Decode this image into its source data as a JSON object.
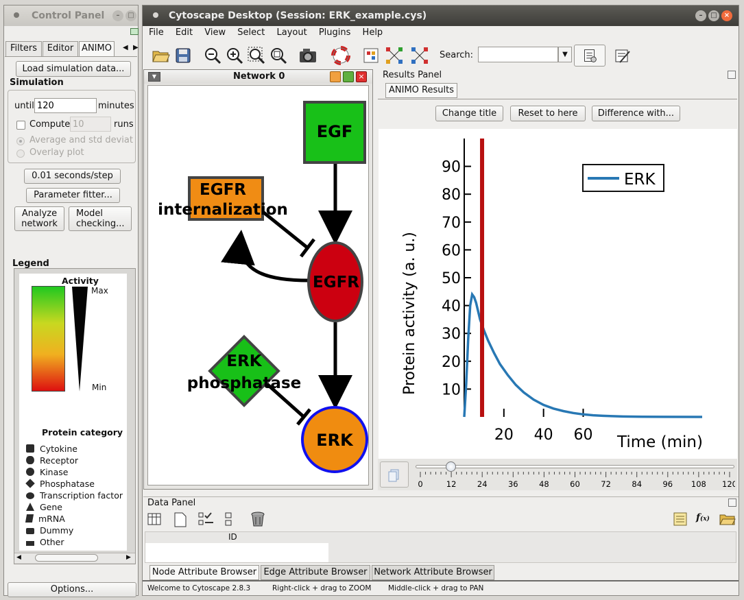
{
  "control_panel": {
    "title": "Control Panel",
    "tabs": [
      "Filters",
      "Editor",
      "ANIMO"
    ],
    "load_button": "Load simulation data...",
    "simulation_heading": "Simulation",
    "until_label": "until",
    "until_value": "120",
    "minutes_label": "minutes",
    "compute_label": "Compute",
    "compute_value": "10",
    "runs_label": "runs",
    "average_label": "Average and std deviati",
    "overlay_label": "Overlay plot",
    "seconds_button": "0.01 seconds/step",
    "parameter_button": "Parameter fitter...",
    "analyze_button_1": "Analyze",
    "analyze_button_2": "network",
    "model_button_1": "Model",
    "model_button_2": "checking...",
    "legend_heading": "Legend",
    "activity_label": "Activity",
    "max_label": "Max",
    "min_label": "Min",
    "protein_category_label": "Protein category",
    "categories": [
      "Cytokine",
      "Receptor",
      "Kinase",
      "Phosphatase",
      "Transcription factor",
      "Gene",
      "mRNA",
      "Dummy",
      "Other"
    ],
    "options_button": "Options..."
  },
  "main_window": {
    "title": "Cytoscape Desktop (Session: ERK_example.cys)",
    "menu": [
      "File",
      "Edit",
      "View",
      "Select",
      "Layout",
      "Plugins",
      "Help"
    ],
    "search_label": "Search:",
    "search_value": ""
  },
  "network": {
    "title": "Network 0",
    "nodes": {
      "egf": "EGF",
      "egfr_internalization_1": "EGFR",
      "egfr_internalization_2": "internalization",
      "egfr": "EGFR",
      "erk_phosphatase_1": "ERK",
      "erk_phosphatase_2": "phosphatase",
      "erk": "ERK"
    }
  },
  "results_panel": {
    "title": "Results Panel",
    "tab": "ANIMO Results",
    "change_title_button": "Change title",
    "reset_button": "Reset to here",
    "difference_button": "Difference with...",
    "slider_value": 12,
    "slider_ticks": [
      "0",
      "12",
      "24",
      "36",
      "48",
      "60",
      "72",
      "84",
      "96",
      "108",
      "120"
    ]
  },
  "chart_data": {
    "type": "line",
    "title": "",
    "xlabel": "Time (min)",
    "ylabel": "Protein activity (a. u.)",
    "xlim": [
      0,
      120
    ],
    "ylim": [
      0,
      100
    ],
    "x_ticks": [
      20,
      40,
      60
    ],
    "y_ticks": [
      10,
      20,
      30,
      40,
      50,
      60,
      70,
      80,
      90
    ],
    "legend_position": "top-right",
    "series": [
      {
        "name": "ERK",
        "color": "#2878b4",
        "x": [
          0,
          1,
          2,
          3,
          4,
          5,
          6,
          7,
          8,
          10,
          12,
          15,
          18,
          22,
          26,
          30,
          35,
          40,
          45,
          50,
          55,
          60,
          65,
          70,
          80,
          90,
          100,
          120
        ],
        "y": [
          0,
          12,
          28,
          40,
          44,
          43,
          41,
          38,
          35,
          31,
          27.5,
          23,
          19,
          15,
          11.5,
          8.8,
          6.2,
          4.3,
          3,
          2.1,
          1.4,
          0.9,
          0.6,
          0.4,
          0.15,
          0.05,
          0.02,
          0
        ]
      }
    ],
    "marker_line": {
      "x": 9,
      "color": "#b81010"
    }
  },
  "data_panel": {
    "title": "Data Panel",
    "column_header": "ID",
    "tabs": [
      "Node Attribute Browser",
      "Edge Attribute Browser",
      "Network Attribute Browser"
    ]
  },
  "status_bar": {
    "welcome": "Welcome to Cytoscape 2.8.3",
    "right_click": "Right-click + drag to ZOOM",
    "middle_click": "Middle-click + drag to PAN"
  },
  "colors": {
    "egf": "#18c018",
    "egfr_internalization": "#f08c14",
    "egfr": "#cc0010",
    "erk_phosphatase": "#18c018",
    "erk": "#f08c10",
    "erk_border": "#1010ee"
  }
}
